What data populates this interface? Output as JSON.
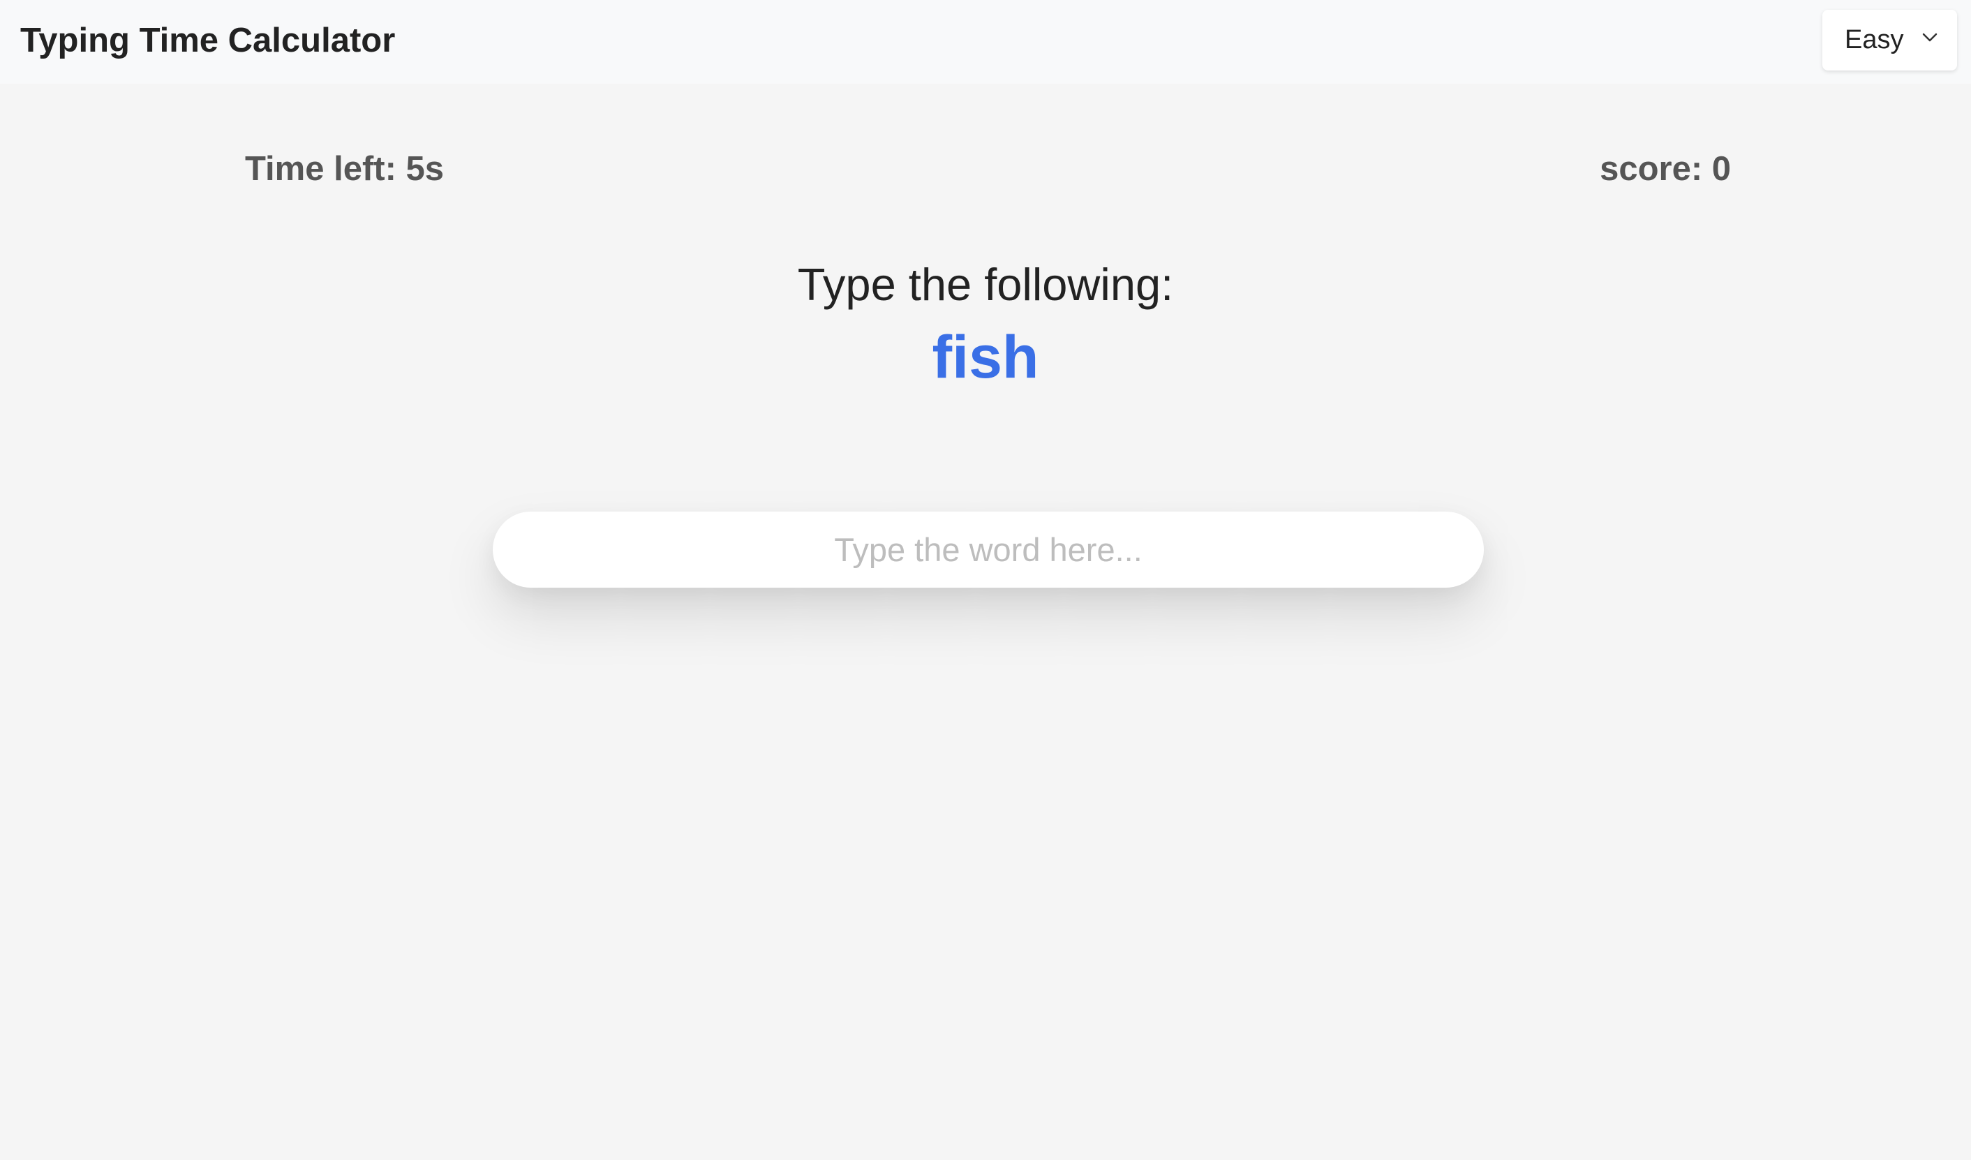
{
  "header": {
    "title": "Typing Time Calculator",
    "difficulty": {
      "selected": "Easy",
      "icon": "chevron-down-icon"
    }
  },
  "stats": {
    "time_left": "Time left: 5s",
    "score": "score: 0"
  },
  "prompt": {
    "label": "Type the following:",
    "word": "fish",
    "word_color": "#3a6fe6"
  },
  "input": {
    "value": "",
    "placeholder": "Type the word here..."
  }
}
